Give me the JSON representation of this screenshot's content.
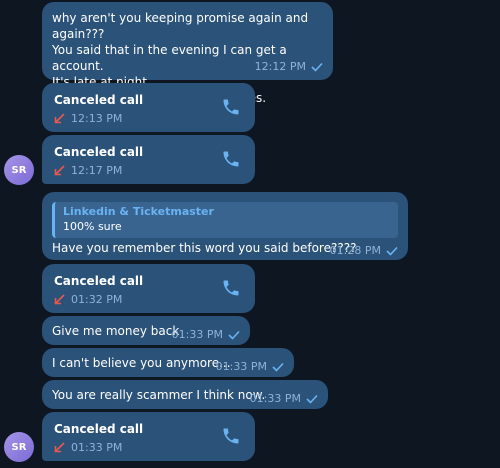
{
  "messages": {
    "m1": {
      "text": "why aren't you keeping promise again and again???\nYou said that in the evening I can get a account.\nIt's late at night.\nBut I haven't received any updates.",
      "time": "12:12 PM"
    },
    "call1": {
      "title": "Canceled call",
      "time": "12:13 PM"
    },
    "call2": {
      "title": "Canceled call",
      "time": "12:17 PM"
    },
    "m2": {
      "reply_name": "Linkedin & Ticketmaster",
      "reply_text": "100% sure",
      "text": "Have you remember this word you said before????",
      "time": "01:28 PM"
    },
    "call3": {
      "title": "Canceled call",
      "time": "01:32 PM"
    },
    "m3": {
      "text": "Give me money back",
      "time": "01:33 PM"
    },
    "m4": {
      "text": "I can't believe you anymore...",
      "time": "01:33 PM"
    },
    "m5": {
      "text": "You are really scammer I think now.",
      "time": "01:33 PM"
    },
    "call4": {
      "title": "Canceled call",
      "time": "01:33 PM"
    }
  },
  "avatar": {
    "initials": "SR"
  },
  "colors": {
    "background": "#0e1621",
    "bubble": "#2b5278",
    "accent": "#6ab3f3",
    "missed_call": "#e8584f",
    "meta": "#8fb3d6"
  },
  "icons": {
    "phone": "phone-icon",
    "check": "check-icon",
    "missed": "missed-call-arrow-icon"
  }
}
